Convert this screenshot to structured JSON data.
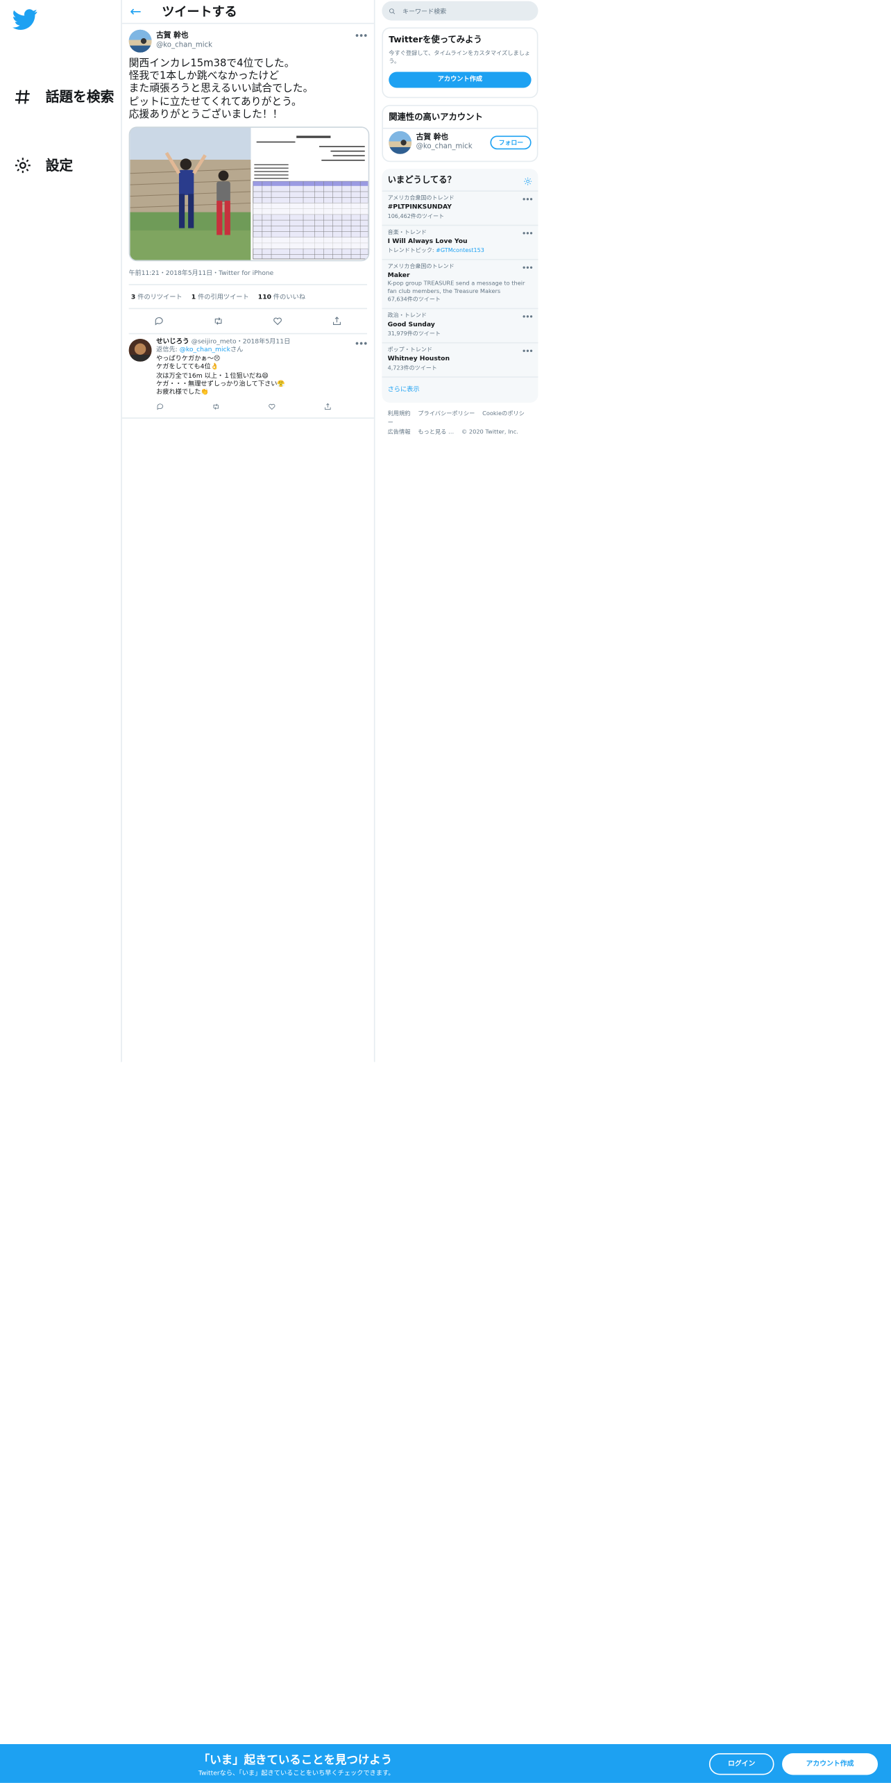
{
  "nav": {
    "explore": "話題を検索",
    "settings": "設定"
  },
  "main": {
    "header": "ツイートする",
    "tweet": {
      "display_name": "古賀 幹也",
      "handle": "@ko_chan_mick",
      "text": "関西インカレ15m38で4位でした。\n怪我で1本しか跳べなかったけど\nまた頑張ろうと思えるいい試合でした。\nピットに立たせてくれてありがとう。\n応援ありがとうございました！！",
      "meta": "午前11:21・2018年5月11日・Twitter for iPhone",
      "retweets": "3",
      "retweets_label": "件のリツイート",
      "quotes": "1",
      "quotes_label": "件の引用ツイート",
      "likes": "110",
      "likes_label": "件のいいね"
    },
    "reply": {
      "display_name": "せいじろう",
      "handle": "@seijiro_meto",
      "date": "・2018年5月11日",
      "reply_to_prefix": "返信先: ",
      "reply_to_handle": "@ko_chan_mick",
      "reply_to_suffix": "さん",
      "text": "やっぱりケガかぁ～😣\nケガをしてても4位👌\n次は万全で16m 以上・１位狙いだね😄\nケガ・・・無理せずしっかり治して下さい😤\nお疲れ様でした👏"
    }
  },
  "right": {
    "search_placeholder": "キーワード検索",
    "signup_card": {
      "title": "Twitterを使ってみよう",
      "subtitle": "今すぐ登録して、タイムラインをカスタマイズしましょう。",
      "button": "アカウント作成"
    },
    "related": {
      "title": "関連性の高いアカウント",
      "name": "古賀 幹也",
      "handle": "@ko_chan_mick",
      "follow": "フォロー"
    },
    "trends": {
      "title": "いまどうしてる？",
      "items": [
        {
          "ctx": "アメリカ合衆国のトレンド",
          "name": "#PLTPINKSUNDAY",
          "desc": "",
          "count": "106,462件のツイート"
        },
        {
          "ctx": "音楽・トレンド",
          "name": "I Will Always Love You",
          "desc": "",
          "topic_prefix": "トレンドトピック: ",
          "topic": "#GTMcontest153",
          "count": ""
        },
        {
          "ctx": "アメリカ合衆国のトレンド",
          "name": "Maker",
          "desc": "K-pop group TREASURE send a message to their fan club members, the Treasure Makers",
          "count": "67,634件のツイート"
        },
        {
          "ctx": "政治・トレンド",
          "name": "Good Sunday",
          "desc": "",
          "count": "31,979件のツイート"
        },
        {
          "ctx": "ポップ・トレンド",
          "name": "Whitney Houston",
          "desc": "",
          "count": "4,723件のツイート"
        }
      ],
      "show_more": "さらに表示"
    },
    "footer": {
      "links": [
        "利用規約",
        "プライバシーポリシー",
        "Cookieのポリシー",
        "広告情報",
        "もっと見る …"
      ],
      "copyright": "© 2020 Twitter, Inc."
    }
  },
  "banner": {
    "title": "「いま」起きていることを見つけよう",
    "subtitle": "Twitterなら、「いま」起きていることをいち早くチェックできます。",
    "login": "ログイン",
    "signup": "アカウント作成"
  },
  "colors": {
    "accent": "#1da1f2",
    "muted": "#657786",
    "border": "#e6ecf0"
  }
}
